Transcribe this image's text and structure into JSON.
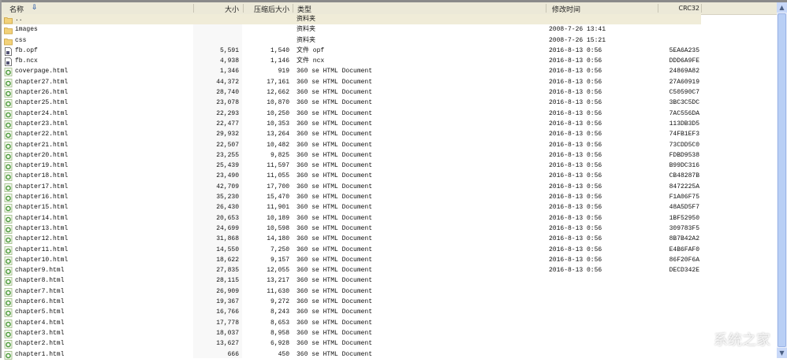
{
  "columns": {
    "name": "名称",
    "sort_icon": "sort-down-arrow",
    "size": "大小",
    "compressed": "压缩后大小",
    "type": "类型",
    "modified": "修改时间",
    "crc": "CRC32"
  },
  "colors": {
    "header_bg": "#ece9d8",
    "selected_bg": "#f0ecd8",
    "scrollbar": "#b9cff5"
  },
  "watermark": "系统之家",
  "rows": [
    {
      "icon": "folder",
      "name": "..",
      "size": "",
      "compressed": "",
      "type": "资料夹",
      "modified": "",
      "crc": ""
    },
    {
      "icon": "folder",
      "name": "images",
      "size": "",
      "compressed": "",
      "type": "资料夹",
      "modified": "2008-7-26 13:41",
      "crc": ""
    },
    {
      "icon": "folder",
      "name": "css",
      "size": "",
      "compressed": "",
      "type": "资料夹",
      "modified": "2008-7-26 15:21",
      "crc": ""
    },
    {
      "icon": "file",
      "name": "fb.opf",
      "size": "5,591",
      "compressed": "1,540",
      "type": "文件 opf",
      "modified": "2016-8-13 0:56",
      "crc": "5EA6A235"
    },
    {
      "icon": "file",
      "name": "fb.ncx",
      "size": "4,938",
      "compressed": "1,146",
      "type": "文件 ncx",
      "modified": "2016-8-13 0:56",
      "crc": "DDD6A9FE"
    },
    {
      "icon": "html",
      "name": "coverpage.html",
      "size": "1,346",
      "compressed": "919",
      "type": "360 se HTML Document",
      "modified": "2016-8-13 0:56",
      "crc": "24869A82"
    },
    {
      "icon": "html",
      "name": "chapter27.html",
      "size": "44,372",
      "compressed": "17,161",
      "type": "360 se HTML Document",
      "modified": "2016-8-13 0:56",
      "crc": "27A60919"
    },
    {
      "icon": "html",
      "name": "chapter26.html",
      "size": "28,740",
      "compressed": "12,662",
      "type": "360 se HTML Document",
      "modified": "2016-8-13 0:56",
      "crc": "C50590C7"
    },
    {
      "icon": "html",
      "name": "chapter25.html",
      "size": "23,078",
      "compressed": "10,870",
      "type": "360 se HTML Document",
      "modified": "2016-8-13 0:56",
      "crc": "3BC3C5DC"
    },
    {
      "icon": "html",
      "name": "chapter24.html",
      "size": "22,293",
      "compressed": "10,250",
      "type": "360 se HTML Document",
      "modified": "2016-8-13 0:56",
      "crc": "7AC556DA"
    },
    {
      "icon": "html",
      "name": "chapter23.html",
      "size": "22,477",
      "compressed": "10,353",
      "type": "360 se HTML Document",
      "modified": "2016-8-13 0:56",
      "crc": "113DB3D5"
    },
    {
      "icon": "html",
      "name": "chapter22.html",
      "size": "29,932",
      "compressed": "13,264",
      "type": "360 se HTML Document",
      "modified": "2016-8-13 0:56",
      "crc": "74FB1EF3"
    },
    {
      "icon": "html",
      "name": "chapter21.html",
      "size": "22,507",
      "compressed": "10,482",
      "type": "360 se HTML Document",
      "modified": "2016-8-13 0:56",
      "crc": "73CDD5C0"
    },
    {
      "icon": "html",
      "name": "chapter20.html",
      "size": "23,255",
      "compressed": "9,825",
      "type": "360 se HTML Document",
      "modified": "2016-8-13 0:56",
      "crc": "FDBD9538"
    },
    {
      "icon": "html",
      "name": "chapter19.html",
      "size": "25,439",
      "compressed": "11,597",
      "type": "360 se HTML Document",
      "modified": "2016-8-13 0:56",
      "crc": "B99DC316"
    },
    {
      "icon": "html",
      "name": "chapter18.html",
      "size": "23,490",
      "compressed": "11,055",
      "type": "360 se HTML Document",
      "modified": "2016-8-13 0:56",
      "crc": "CB48287B"
    },
    {
      "icon": "html",
      "name": "chapter17.html",
      "size": "42,709",
      "compressed": "17,700",
      "type": "360 se HTML Document",
      "modified": "2016-8-13 0:56",
      "crc": "8472225A"
    },
    {
      "icon": "html",
      "name": "chapter16.html",
      "size": "35,230",
      "compressed": "15,470",
      "type": "360 se HTML Document",
      "modified": "2016-8-13 0:56",
      "crc": "F1A06F75"
    },
    {
      "icon": "html",
      "name": "chapter15.html",
      "size": "26,430",
      "compressed": "11,901",
      "type": "360 se HTML Document",
      "modified": "2016-8-13 0:56",
      "crc": "48A5D5F7"
    },
    {
      "icon": "html",
      "name": "chapter14.html",
      "size": "20,653",
      "compressed": "10,189",
      "type": "360 se HTML Document",
      "modified": "2016-8-13 0:56",
      "crc": "1BF52950"
    },
    {
      "icon": "html",
      "name": "chapter13.html",
      "size": "24,699",
      "compressed": "10,598",
      "type": "360 se HTML Document",
      "modified": "2016-8-13 0:56",
      "crc": "309783F5"
    },
    {
      "icon": "html",
      "name": "chapter12.html",
      "size": "31,868",
      "compressed": "14,180",
      "type": "360 se HTML Document",
      "modified": "2016-8-13 0:56",
      "crc": "8B7B42A2"
    },
    {
      "icon": "html",
      "name": "chapter11.html",
      "size": "14,550",
      "compressed": "7,250",
      "type": "360 se HTML Document",
      "modified": "2016-8-13 0:56",
      "crc": "E4B6FAF0"
    },
    {
      "icon": "html",
      "name": "chapter10.html",
      "size": "18,622",
      "compressed": "9,157",
      "type": "360 se HTML Document",
      "modified": "2016-8-13 0:56",
      "crc": "86F20F6A"
    },
    {
      "icon": "html",
      "name": "chapter9.html",
      "size": "27,835",
      "compressed": "12,055",
      "type": "360 se HTML Document",
      "modified": "2016-8-13 0:56",
      "crc": "DECD342E"
    },
    {
      "icon": "html",
      "name": "chapter8.html",
      "size": "28,115",
      "compressed": "13,217",
      "type": "360 se HTML Document",
      "modified": "",
      "crc": ""
    },
    {
      "icon": "html",
      "name": "chapter7.html",
      "size": "26,909",
      "compressed": "11,630",
      "type": "360 se HTML Document",
      "modified": "",
      "crc": ""
    },
    {
      "icon": "html",
      "name": "chapter6.html",
      "size": "19,367",
      "compressed": "9,272",
      "type": "360 se HTML Document",
      "modified": "",
      "crc": ""
    },
    {
      "icon": "html",
      "name": "chapter5.html",
      "size": "16,766",
      "compressed": "8,243",
      "type": "360 se HTML Document",
      "modified": "",
      "crc": ""
    },
    {
      "icon": "html",
      "name": "chapter4.html",
      "size": "17,778",
      "compressed": "8,653",
      "type": "360 se HTML Document",
      "modified": "",
      "crc": ""
    },
    {
      "icon": "html",
      "name": "chapter3.html",
      "size": "18,037",
      "compressed": "8,958",
      "type": "360 se HTML Document",
      "modified": "",
      "crc": ""
    },
    {
      "icon": "html",
      "name": "chapter2.html",
      "size": "13,627",
      "compressed": "6,928",
      "type": "360 se HTML Document",
      "modified": "",
      "crc": ""
    },
    {
      "icon": "html",
      "name": "chapter1.html",
      "size": "666",
      "compressed": "450",
      "type": "360 se HTML Document",
      "modified": "",
      "crc": ""
    }
  ]
}
